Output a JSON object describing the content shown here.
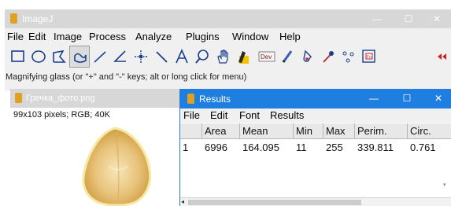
{
  "main_window": {
    "title": "ImageJ",
    "controls": {
      "minimize": "—",
      "maximize": "☐",
      "close": "✕"
    }
  },
  "menubar": {
    "items": [
      "File",
      "Edit",
      "Image",
      "Process",
      "Analyze",
      "Plugins",
      "Window",
      "Help"
    ]
  },
  "toolbar": {
    "tools": [
      "rectangle-tool",
      "oval-tool",
      "polygon-tool",
      "freehand-tool",
      "line-tool",
      "angle-tool",
      "point-tool",
      "wand-tool",
      "text-tool",
      "magnifying-glass-tool",
      "hand-tool",
      "color-picker-tool",
      "developer-menu",
      "pencil-tool",
      "brush-tool",
      "flood-fill-tool",
      "dropper-tool",
      "arrow-tool",
      "stacks-tool",
      "more-tools"
    ],
    "developer_label": "Dev",
    "selected_tool": "magnifying-glass-tool"
  },
  "status": {
    "text": "Magnifying glass (or \"+\" and \"-\" keys; alt or long click for menu)"
  },
  "image_window": {
    "title": "Гречка_фото.png",
    "info": "99x103 pixels; RGB; 40K"
  },
  "results_window": {
    "title": "Results",
    "controls": {
      "minimize": "—",
      "maximize": "☐",
      "close": "✕"
    },
    "menu": [
      "File",
      "Edit",
      "Font",
      "Results"
    ],
    "table": {
      "headers": [
        "",
        "Area",
        "Mean",
        "Min",
        "Max",
        "Perim.",
        "Circ."
      ],
      "rows": [
        [
          "1",
          "6996",
          "164.095",
          "11",
          "255",
          "339.811",
          "0.761"
        ]
      ]
    }
  },
  "colors": {
    "titlebar_inactive": "#d7d7d7",
    "titlebar_active": "#1e7fe0",
    "window_bg": "#f0f0f0"
  }
}
